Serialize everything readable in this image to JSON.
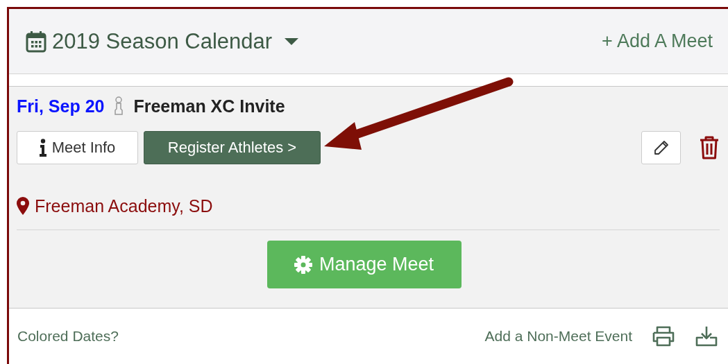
{
  "header": {
    "title": "2019 Season Calendar",
    "add_button": "+ Add A Meet"
  },
  "meet": {
    "date": "Fri, Sep 20",
    "name": "Freeman XC Invite",
    "info_button": "Meet Info",
    "register_button": "Register Athletes >",
    "location": "Freeman Academy, SD",
    "manage_button": "Manage Meet"
  },
  "footer": {
    "colored_dates": "Colored Dates?",
    "add_event": "Add a Non-Meet Event"
  }
}
